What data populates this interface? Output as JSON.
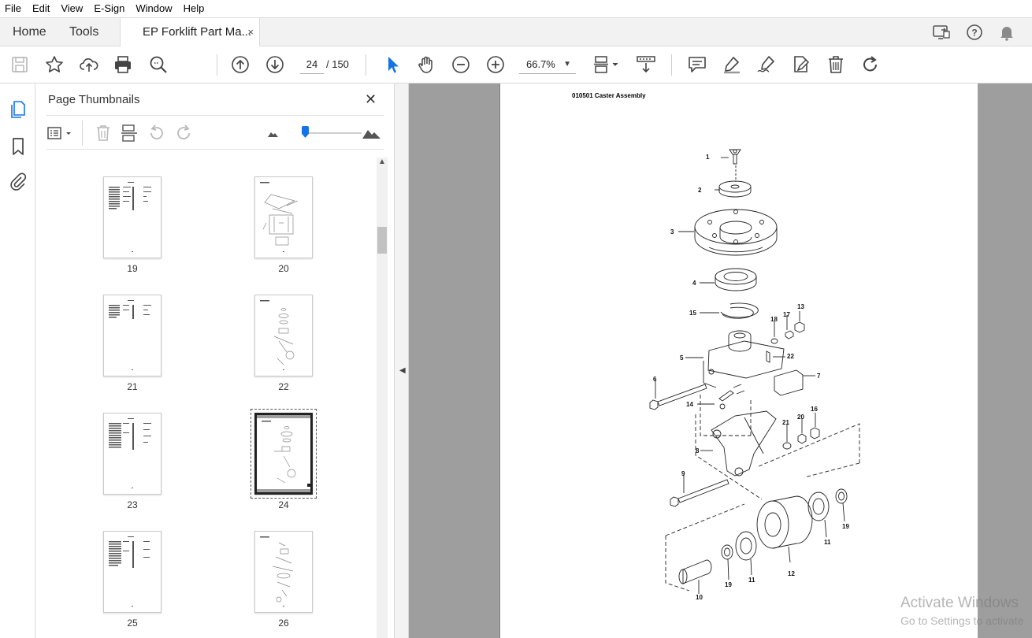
{
  "menu": [
    "File",
    "Edit",
    "View",
    "E-Sign",
    "Window",
    "Help"
  ],
  "tabs": {
    "home": "Home",
    "tools": "Tools",
    "document": "EP Forklift Part Ma...",
    "close": "×"
  },
  "toolbar": {
    "current_page": "24",
    "page_total": "/  150",
    "zoom": "66.7%"
  },
  "panel": {
    "title": "Page Thumbnails",
    "thumbnails": [
      {
        "label": "19",
        "kind": "list"
      },
      {
        "label": "20",
        "kind": "drawing"
      },
      {
        "label": "21",
        "kind": "list"
      },
      {
        "label": "22",
        "kind": "drawing"
      },
      {
        "label": "23",
        "kind": "list"
      },
      {
        "label": "24",
        "kind": "drawing",
        "selected": true
      },
      {
        "label": "25",
        "kind": "list"
      },
      {
        "label": "26",
        "kind": "drawing"
      }
    ]
  },
  "document": {
    "heading": "010501 Caster Assembly",
    "callouts": [
      "1",
      "2",
      "3",
      "4",
      "15",
      "18",
      "17",
      "13",
      "5",
      "22",
      "7",
      "6",
      "14",
      "21",
      "20",
      "16",
      "8",
      "9",
      "11",
      "19",
      "12",
      "11",
      "19",
      "10"
    ]
  },
  "watermark": {
    "line1": "Activate Windows",
    "line2": "Go to Settings to activate"
  },
  "colors": {
    "accent": "#1473e6",
    "canvas": "#9e9e9e"
  }
}
